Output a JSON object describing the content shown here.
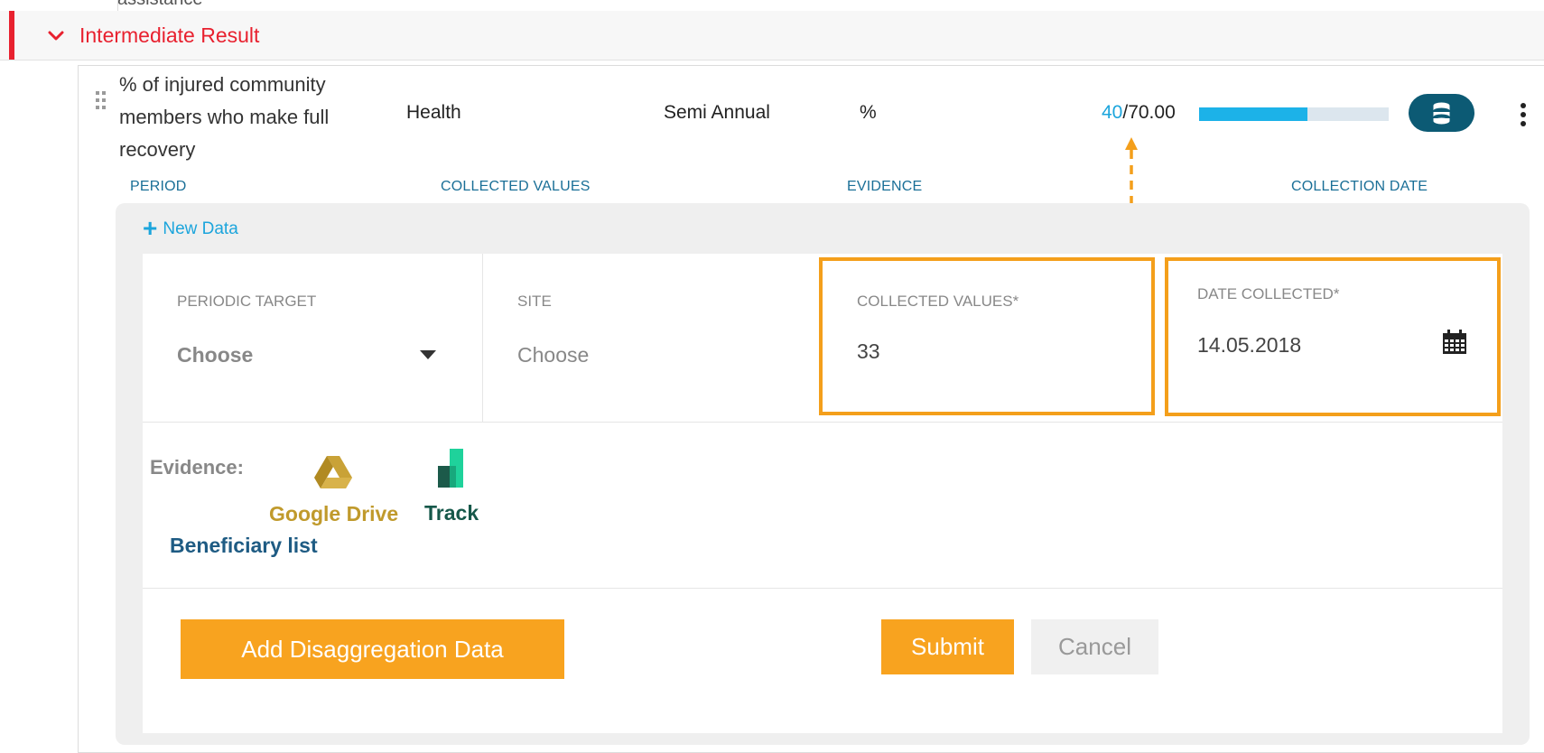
{
  "top": {
    "cut_text": "assistance"
  },
  "section": {
    "title": "Intermediate Result"
  },
  "indicator": {
    "name": "% of injured community members who make full recovery",
    "sector": "Health",
    "frequency": "Semi Annual",
    "unit": "%",
    "current": "40",
    "target": "/70.00",
    "progress_fraction": 0.57
  },
  "columns": [
    "PERIOD",
    "COLLECTED VALUES",
    "EVIDENCE",
    "COLLECTION DATE"
  ],
  "form": {
    "new_data_label": "New Data",
    "periodic_target": {
      "label": "PERIODIC TARGET",
      "value": "Choose"
    },
    "site": {
      "label": "SITE",
      "value": "Choose"
    },
    "collected_values": {
      "label": "COLLECTED VALUES*",
      "value": "33"
    },
    "date_collected": {
      "label": "DATE COLLECTED*",
      "value": "14.05.2018"
    },
    "evidence_label": "Evidence:",
    "evidence_sources": [
      {
        "label": "Google Drive",
        "icon": "google-drive-icon"
      },
      {
        "label": "Track",
        "icon": "track-icon"
      }
    ],
    "beneficiary_list": "Beneficiary list",
    "buttons": {
      "disaggregation": "Add Disaggregation Data",
      "submit": "Submit",
      "cancel": "Cancel"
    }
  },
  "colors": {
    "accent_red": "#e8212f",
    "highlight_orange": "#f49f1b",
    "progress_blue": "#1cb2e8",
    "db_button": "#0c5a74"
  }
}
